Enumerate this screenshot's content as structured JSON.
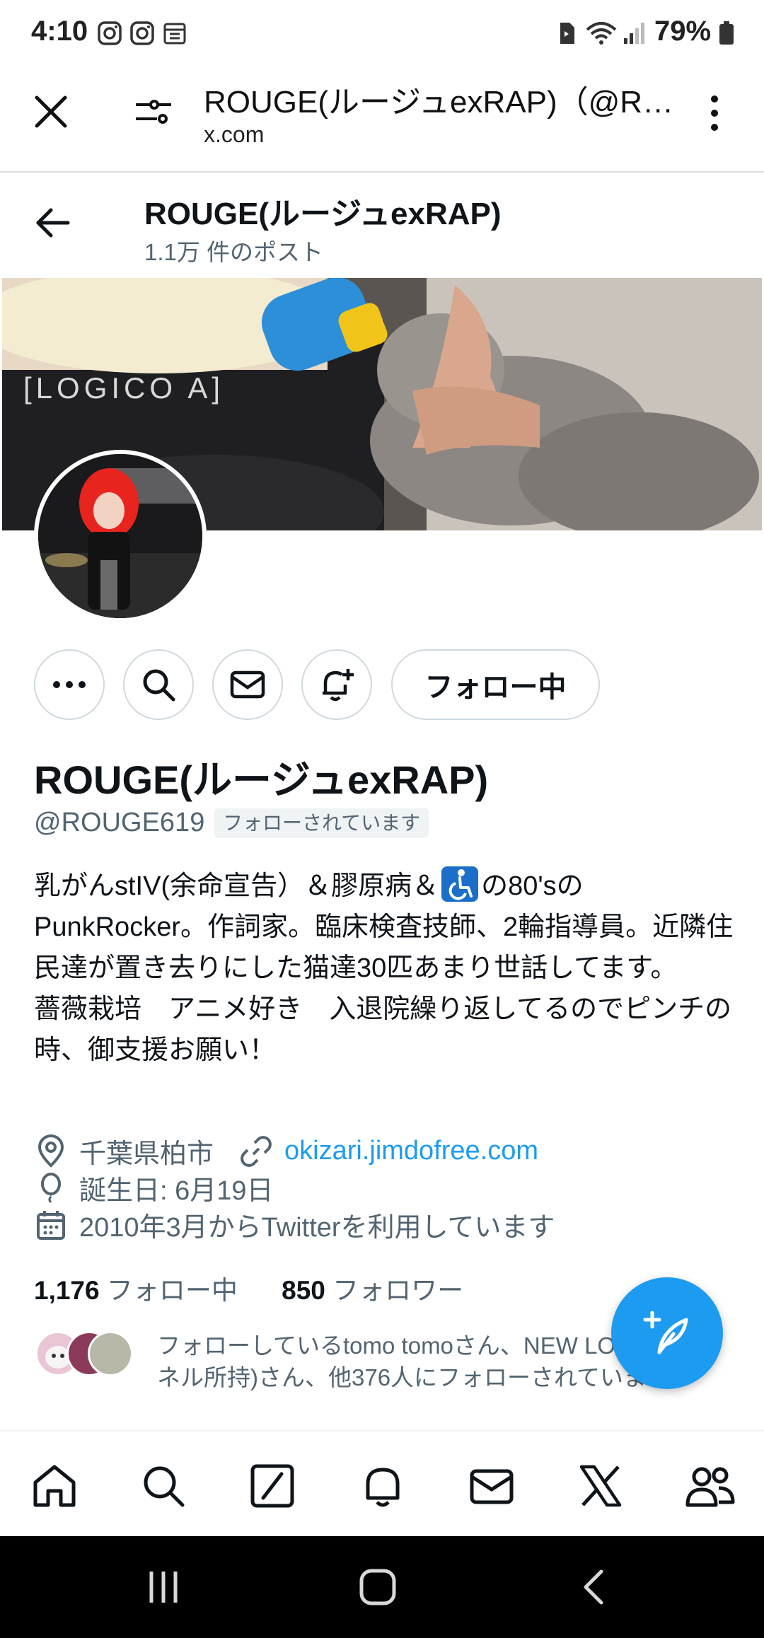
{
  "status_bar": {
    "time": "4:10",
    "battery": "79%",
    "icons": [
      "instagram-icon",
      "instagram-icon",
      "calendar-icon",
      "sim-icon",
      "wifi-icon",
      "signal-icon",
      "battery-icon"
    ]
  },
  "browser": {
    "title": "ROUGE(ルージュexRAP)（@ROUGE619）さん / X",
    "url": "x.com",
    "icons": [
      "close-icon",
      "tune-icon",
      "more-vert-icon"
    ]
  },
  "profile_header": {
    "name": "ROUGE(ルージュexRAP)",
    "posts": "1.1万 件のポスト"
  },
  "actions": {
    "follow_label": "フォロー中"
  },
  "profile": {
    "display_name": "ROUGE(ルージュexRAP)",
    "handle": "@ROUGE619",
    "follows_you": "フォローされています",
    "bio_part1": "乳がんstIV(余命宣告）＆膠原病＆",
    "bio_part2": "の80'sの\nPunkRocker。作詞家。臨床検査技師、2輪指導員。近隣住民達が置き去りにした猫達30匹あまり世話してます。\n薔薇栽培　アニメ好き　入退院繰り返してるのでピンチの時、御支援お願い！",
    "location": "千葉県柏市",
    "website": "okizari.jimdofree.com",
    "birthday": "誕生日: 6月19日",
    "joined": "2010年3月からTwitterを利用しています",
    "following_count": "1,176",
    "following_label": "フォロー中",
    "followers_count": "850",
    "followers_label": "フォロワー",
    "followed_by": "フォローしているtomo tomoさん、NEW LOVE(白パネル所持)さん、他376人にフォローされています"
  },
  "colors": {
    "accent": "#1d9bf0",
    "text": "#0f1419",
    "secondary": "#536471"
  }
}
